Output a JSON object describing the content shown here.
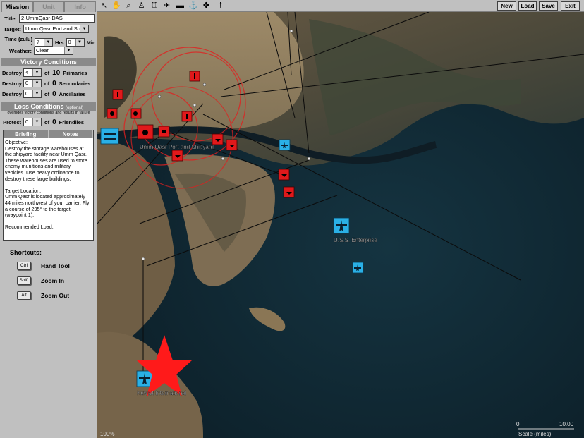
{
  "tabs": {
    "mission": "Mission",
    "unit": "Unit",
    "info": "Info"
  },
  "title": {
    "label": "Title:",
    "value": "2-UmmQasr-DAS"
  },
  "target": {
    "label": "Target:",
    "value": "Umm Qasr Port and Ship"
  },
  "time": {
    "label": "Time (zulu) :",
    "hrs": "7",
    "hrs_label": "Hrs",
    "min": "0",
    "min_label": "Min"
  },
  "weather": {
    "label": "Weather:",
    "value": "Clear"
  },
  "victory": {
    "header": "Victory Conditions",
    "rows": [
      {
        "label": "Destroy",
        "value": "4",
        "of": "of",
        "total": "10",
        "kind": "Primaries"
      },
      {
        "label": "Destroy",
        "value": "0",
        "of": "of",
        "total": "0",
        "kind": "Secondaries"
      },
      {
        "label": "Destroy",
        "value": "0",
        "of": "of",
        "total": "0",
        "kind": "Ancillaries"
      }
    ]
  },
  "loss": {
    "header": "Loss Conditions",
    "optional": "(optional)",
    "note": "overrides victory conditions and results in failure",
    "protect_label": "Protect",
    "protect_value": "0",
    "of": "of",
    "total": "0",
    "kind": "Friendlies"
  },
  "briefing": {
    "tab_briefing": "Briefing",
    "tab_notes": "Notes",
    "text": "Objective:\nDestroy the storage warehouses at the shipyard facility near Umm Qasr. These warehouses are used to store enemy munitions and military vehicles.  Use heavy ordinance to destroy these large buildings.\n\nTarget Location:\nUmm Qasr is located approximately 44 miles northwest of your carrier. Fly a course of 295° to the target (waypoint 1).\n\nRecommended Load:"
  },
  "shortcuts": {
    "title": "Shortcuts:",
    "items": [
      {
        "key": "Ctrl",
        "label": "Hand Tool"
      },
      {
        "key": "Shift",
        "label": "Zoom In"
      },
      {
        "key": "Alt",
        "label": "Zoom Out"
      }
    ]
  },
  "toolbar": {
    "tools": [
      {
        "icon": "pointer-icon",
        "glyph": "↖"
      },
      {
        "icon": "hand-icon",
        "glyph": "✋"
      },
      {
        "icon": "magnifier-icon",
        "glyph": "⌕"
      },
      {
        "icon": "soldier-icon",
        "glyph": "♙"
      },
      {
        "icon": "ground-unit-icon",
        "glyph": "♖"
      },
      {
        "icon": "aircraft-icon",
        "glyph": "✈"
      },
      {
        "icon": "tank-icon",
        "glyph": "▬"
      },
      {
        "icon": "ship-icon",
        "glyph": "⚓"
      },
      {
        "icon": "helicopter-icon",
        "glyph": "✤"
      },
      {
        "icon": "beacon-icon",
        "glyph": "†"
      }
    ],
    "buttons": {
      "new": "New",
      "load": "Load",
      "save": "Save",
      "exit": "Exit"
    }
  },
  "map": {
    "labels": {
      "target": "Umm Qasr Port and Shipyard",
      "carrier": "U.S.S. Enterprise",
      "airport": "Kuwait International"
    },
    "zoom": "100%",
    "scale_start": "0",
    "scale_end": "10.00",
    "scale_label": "Scale (miles)",
    "colors": {
      "enemy": "#e0191b",
      "friendly": "#2ab0e6",
      "waypoint_star": "#ff1a1a"
    }
  }
}
